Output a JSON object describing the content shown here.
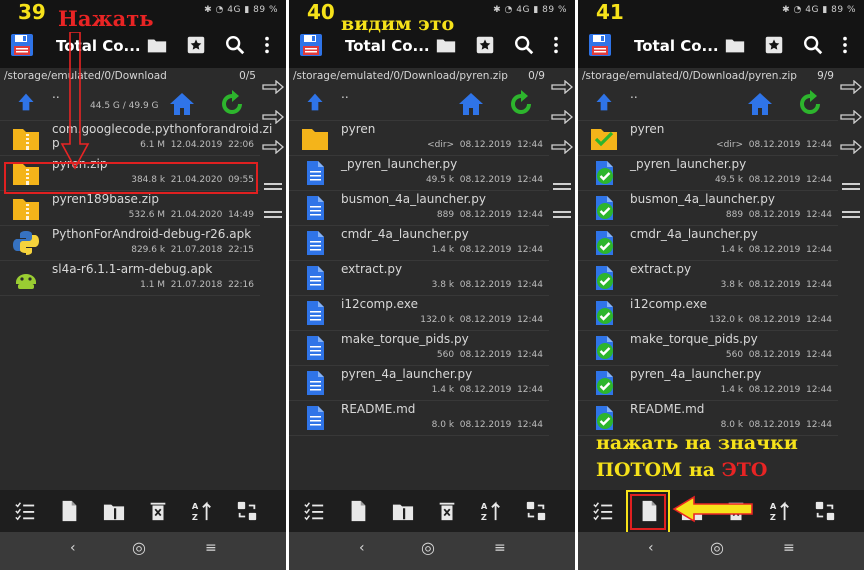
{
  "app": {
    "title": "Total Co...",
    "status_icons": "✱ ◔ 4G ▮ 89 %"
  },
  "colors": {
    "accent_blue": "#2f74e8",
    "folder_yellow": "#f4b41a",
    "check_green": "#2db52d",
    "annot_yellow": "#f6e21a",
    "annot_red": "#e82424"
  },
  "panel1": {
    "step": "39",
    "annotation": "Нажать",
    "path": "/storage/emulated/0/Download",
    "count": "0/5",
    "up": {
      "label": "..",
      "space": "44.5 G / 49.9 G"
    },
    "rows": [
      {
        "name": "com.googlecode.pythonforandroid.zi",
        "name2": "p",
        "size": "6.1 M",
        "date": "12.04.2019",
        "time": "22:06",
        "icon": "zip-folder-icon"
      },
      {
        "name": "pyren.zip",
        "size": "384.8 k",
        "date": "21.04.2020",
        "time": "09:55",
        "icon": "zip-folder-icon"
      },
      {
        "name": "pyren189base.zip",
        "size": "532.6 M",
        "date": "21.04.2020",
        "time": "14:49",
        "icon": "zip-folder-icon"
      },
      {
        "name": "PythonForAndroid-debug-r26.apk",
        "size": "829.6 k",
        "date": "21.07.2018",
        "time": "22:15",
        "icon": "python-apk-icon"
      },
      {
        "name": "sl4a-r6.1.1-arm-debug.apk",
        "size": "1.1 M",
        "date": "21.07.2018",
        "time": "22:16",
        "icon": "android-apk-icon"
      }
    ]
  },
  "panel2": {
    "step": "40",
    "annotation": "видим это",
    "path": "/storage/emulated/0/Download/pyren.zip",
    "count": "0/9",
    "up": {
      "label": ".."
    },
    "rows": [
      {
        "name": "pyren",
        "size": "<dir>",
        "date": "08.12.2019",
        "time": "12:44"
      },
      {
        "name": "_pyren_launcher.py",
        "size": "49.5 k",
        "date": "08.12.2019",
        "time": "12:44"
      },
      {
        "name": "busmon_4a_launcher.py",
        "size": "889",
        "date": "08.12.2019",
        "time": "12:44"
      },
      {
        "name": "cmdr_4a_launcher.py",
        "size": "1.4 k",
        "date": "08.12.2019",
        "time": "12:44"
      },
      {
        "name": "extract.py",
        "size": "3.8 k",
        "date": "08.12.2019",
        "time": "12:44"
      },
      {
        "name": "i12comp.exe",
        "size": "132.0 k",
        "date": "08.12.2019",
        "time": "12:44"
      },
      {
        "name": "make_torque_pids.py",
        "size": "560",
        "date": "08.12.2019",
        "time": "12:44"
      },
      {
        "name": "pyren_4a_launcher.py",
        "size": "1.4 k",
        "date": "08.12.2019",
        "time": "12:44"
      },
      {
        "name": "README.md",
        "size": "8.0 k",
        "date": "08.12.2019",
        "time": "12:44"
      }
    ]
  },
  "panel3": {
    "step": "41",
    "path": "/storage/emulated/0/Download/pyren.zip",
    "count": "9/9",
    "up": {
      "label": ".."
    },
    "annotation_line1": "нажать на значки",
    "annotation_line2_a": "ПОТОМ на ",
    "annotation_line2_b": "ЭТО",
    "rows": [
      {
        "name": "pyren",
        "size": "<dir>",
        "date": "08.12.2019",
        "time": "12:44"
      },
      {
        "name": "_pyren_launcher.py",
        "size": "49.5 k",
        "date": "08.12.2019",
        "time": "12:44"
      },
      {
        "name": "busmon_4a_launcher.py",
        "size": "889",
        "date": "08.12.2019",
        "time": "12:44"
      },
      {
        "name": "cmdr_4a_launcher.py",
        "size": "1.4 k",
        "date": "08.12.2019",
        "time": "12:44"
      },
      {
        "name": "extract.py",
        "size": "3.8 k",
        "date": "08.12.2019",
        "time": "12:44"
      },
      {
        "name": "i12comp.exe",
        "size": "132.0 k",
        "date": "08.12.2019",
        "time": "12:44"
      },
      {
        "name": "make_torque_pids.py",
        "size": "560",
        "date": "08.12.2019",
        "time": "12:44"
      },
      {
        "name": "pyren_4a_launcher.py",
        "size": "1.4 k",
        "date": "08.12.2019",
        "time": "12:44"
      },
      {
        "name": "README.md",
        "size": "8.0 k",
        "date": "08.12.2019",
        "time": "12:44"
      }
    ]
  },
  "bottom_icons": [
    "select-icon",
    "file-icon",
    "zip-pack-icon",
    "delete-icon",
    "sort-icon",
    "swap-icon"
  ],
  "nav": {
    "back": "‹",
    "home": "◎",
    "menu": "≡"
  }
}
